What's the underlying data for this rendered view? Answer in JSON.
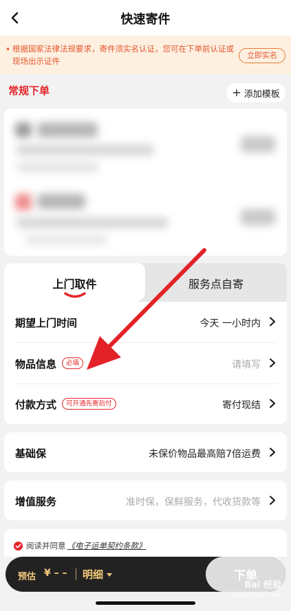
{
  "header": {
    "title": "快速寄件"
  },
  "notice": {
    "text": "根据国家法律法规要求，寄件须实名认证，您可在下单前认证或现场出示证件",
    "verify_label": "立即实名"
  },
  "order_section": {
    "title": "常规下单",
    "add_template_label": "添加模板"
  },
  "tabs": [
    {
      "label": "上门取件",
      "active": true
    },
    {
      "label": "服务点自寄",
      "active": false
    }
  ],
  "form_rows": [
    {
      "label": "期望上门时间",
      "tag": "",
      "value": "今天 一小时内",
      "placeholder": false
    },
    {
      "label": "物品信息",
      "tag": "必填",
      "value": "请填写",
      "placeholder": true
    },
    {
      "label": "付款方式",
      "tag": "可开通先寄后付",
      "value": "寄付现结",
      "placeholder": false
    }
  ],
  "insurance": {
    "label": "基础保",
    "value": "未保价物品最高赔7倍运费"
  },
  "value_added": {
    "label": "增值服务",
    "value": "准时保，保鲜服务，代收货款等"
  },
  "agreement": {
    "prefix": "阅读并同意",
    "link": "《电子运单契约条款》"
  },
  "bottom_bar": {
    "estimate_label": "预估",
    "estimate_value": "¥ – –",
    "detail_label": "明细",
    "submit_label": "下单"
  },
  "watermark": {
    "line1": "Bai 经验",
    "line2": "jingyan.baidu.com"
  },
  "colors": {
    "accent_red": "#e5262b",
    "notice_bg": "#fdf0e1",
    "notice_text": "#e4572e",
    "bar_bg": "#222222",
    "bar_text": "#f3c97c",
    "annotation_arrow": "#e32228"
  }
}
